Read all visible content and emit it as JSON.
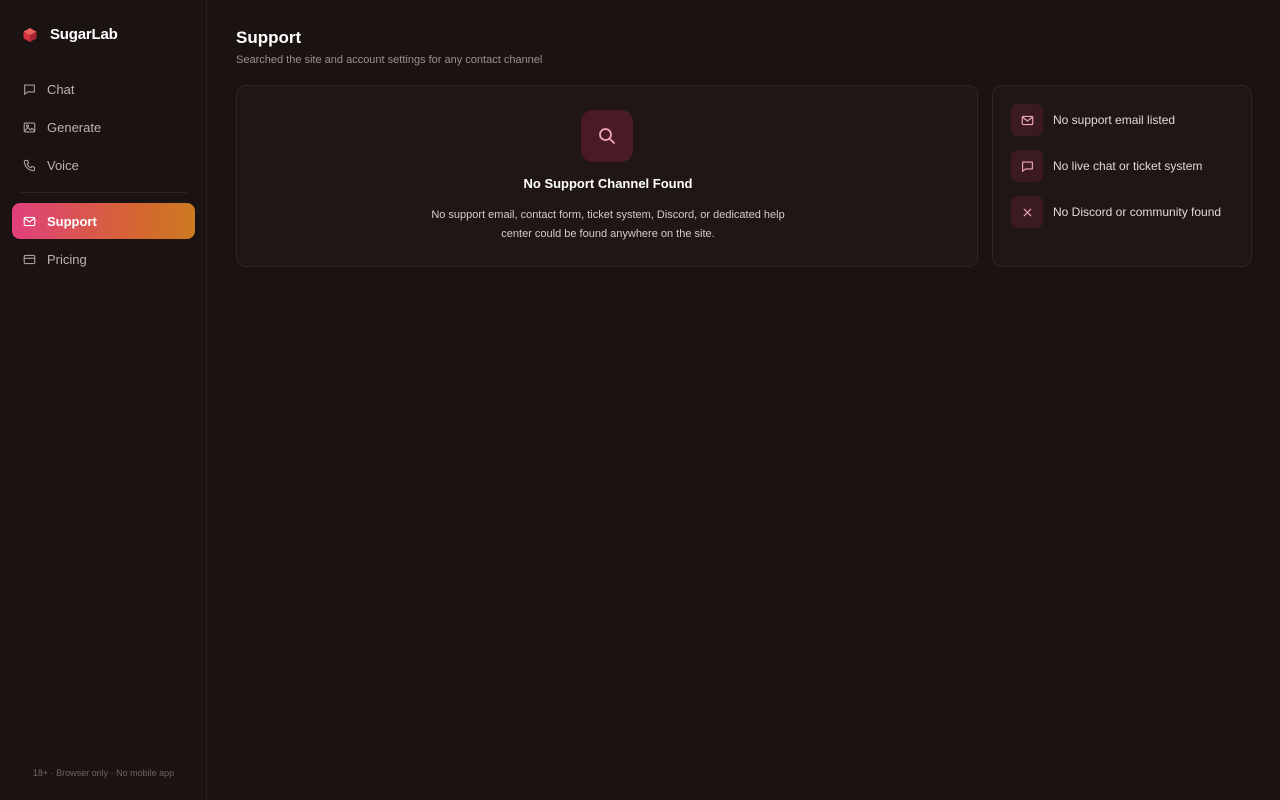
{
  "brand": {
    "name": "SugarLab"
  },
  "nav": {
    "items": [
      {
        "label": "Chat",
        "icon": "chat-icon"
      },
      {
        "label": "Generate",
        "icon": "image-icon"
      },
      {
        "label": "Voice",
        "icon": "phone-icon"
      },
      {
        "label": "Support",
        "icon": "mail-icon",
        "active": true
      },
      {
        "label": "Pricing",
        "icon": "credit-card-icon"
      }
    ]
  },
  "footer": {
    "text": "18+ · Browser only · No mobile app"
  },
  "page": {
    "title": "Support",
    "subtitle": "Searched the site and account settings for any contact channel"
  },
  "empty_state": {
    "icon": "search-icon",
    "title": "No Support Channel Found",
    "description": "No support email, contact form, ticket system, Discord, or dedicated help center could be found anywhere on the site."
  },
  "status_items": [
    {
      "icon": "mail-icon",
      "label": "No support email listed"
    },
    {
      "icon": "chat-icon",
      "label": "No live chat or ticket system"
    },
    {
      "icon": "close-icon",
      "label": "No Discord or community found"
    }
  ],
  "colors": {
    "background": "#1b1312",
    "accent_start": "#e0407c",
    "accent_end": "#cd7a22",
    "icon_tint": "#f0a8b8",
    "icon_badge": "#4a1a26"
  }
}
